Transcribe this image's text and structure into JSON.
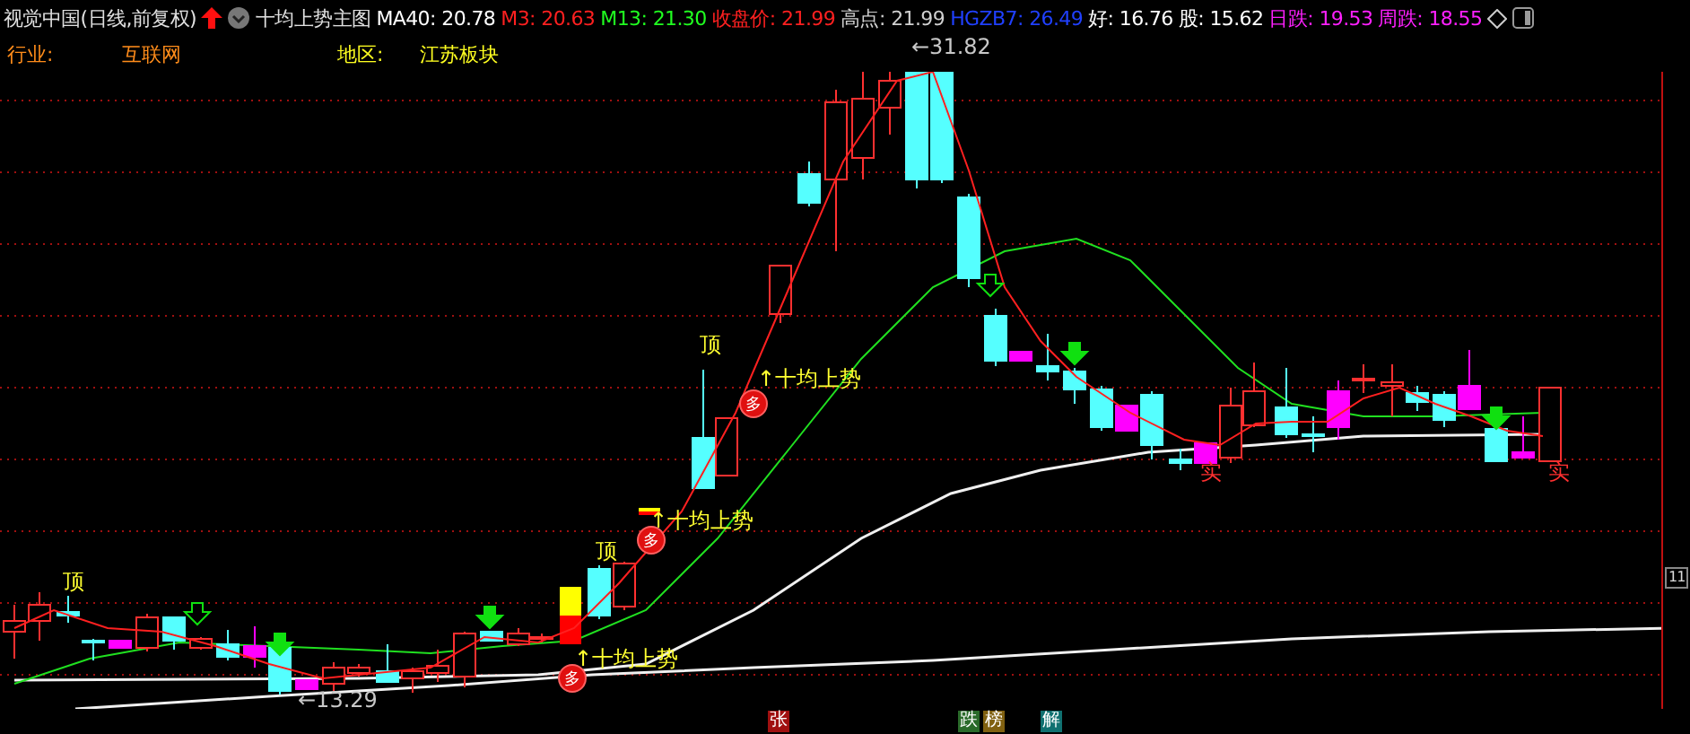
{
  "header": {
    "title": "视觉中国(日线,前复权)",
    "indicator_name": "十均上势主图",
    "values": [
      {
        "label": "MA40:",
        "value": "20.78",
        "color": "#ffffff"
      },
      {
        "label": "M3:",
        "value": "20.63",
        "color": "#ff2020"
      },
      {
        "label": "M13:",
        "value": "21.30",
        "color": "#20ff20"
      },
      {
        "label": "收盘价:",
        "value": "21.99",
        "color": "#ff2020"
      },
      {
        "label": "高点:",
        "value": "21.99",
        "color": "#d0d0d0"
      },
      {
        "label": "HGZB7:",
        "value": "26.49",
        "color": "#2040ff"
      },
      {
        "label": "好:",
        "value": "16.76",
        "color": "#ffffff"
      },
      {
        "label": "股:",
        "value": "15.62",
        "color": "#ffffff"
      },
      {
        "label": "日跌:",
        "value": "19.53",
        "color": "#ff20ff"
      },
      {
        "label": "周跌:",
        "value": "18.55",
        "color": "#ff20ff"
      }
    ]
  },
  "info": [
    {
      "label": "行业:",
      "value": "互联网",
      "color": "#ff8c1a"
    },
    {
      "label": "地区:",
      "value": "江苏板块",
      "color": "#ffff20"
    }
  ],
  "chart": {
    "labels": [
      {
        "kind": "signal",
        "text": "顶"
      },
      {
        "kind": "signal",
        "text": "顶"
      },
      {
        "kind": "signal",
        "text": "顶"
      },
      {
        "kind": "trend",
        "text": "↑十均上势"
      },
      {
        "kind": "trend",
        "text": "↑十均上势"
      },
      {
        "kind": "trend",
        "text": "↑十均上势"
      },
      {
        "kind": "price",
        "text": "←31.82"
      },
      {
        "kind": "price",
        "text": "←13.29"
      },
      {
        "kind": "sell",
        "text": "实"
      },
      {
        "kind": "sell",
        "text": "实"
      }
    ],
    "badges": [
      {
        "text": "多"
      },
      {
        "text": "多"
      },
      {
        "text": "多"
      }
    ],
    "axis_label": "11"
  },
  "tabs": [
    {
      "label": "张",
      "color": "#a01010"
    },
    {
      "label": "跌",
      "color": "#2a6a2a"
    },
    {
      "label": "榜",
      "color": "#806010"
    },
    {
      "label": "解",
      "color": "#107070"
    }
  ]
}
